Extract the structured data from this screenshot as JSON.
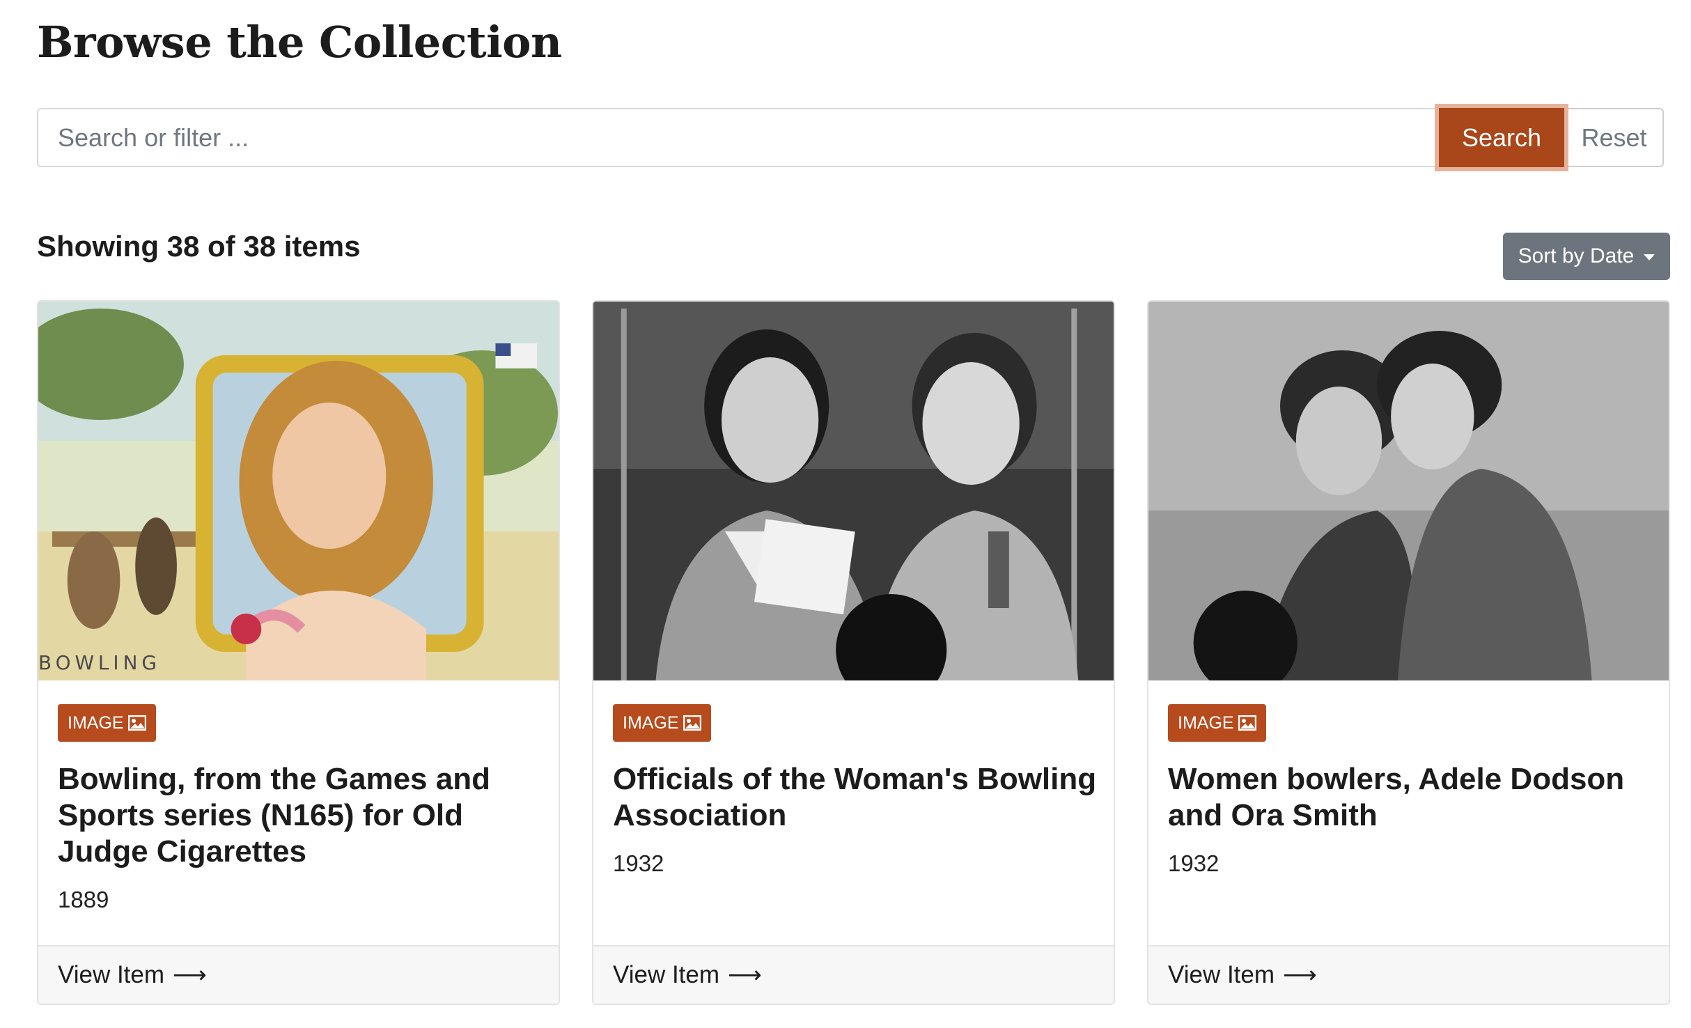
{
  "page": {
    "title": "Browse the Collection"
  },
  "search": {
    "placeholder": "Search or filter ...",
    "value": "",
    "search_label": "Search",
    "reset_label": "Reset"
  },
  "results": {
    "count_text": "Showing 38 of 38 items",
    "sort_label": "Sort by Date"
  },
  "colors": {
    "accent": "#b64c1e",
    "sort_button": "#6c757d"
  },
  "cards": [
    {
      "badge": "IMAGE",
      "badge_icon": "image-icon",
      "title": "Bowling, from the Games and Sports series (N165) for Old Judge Cigarettes",
      "date": "1889",
      "link": "View Item",
      "image_caption": "BOWLING"
    },
    {
      "badge": "IMAGE",
      "badge_icon": "image-icon",
      "title": "Officials of the Woman's Bowling Association",
      "date": "1932",
      "link": "View Item"
    },
    {
      "badge": "IMAGE",
      "badge_icon": "image-icon",
      "title": "Women bowlers, Adele Dodson and Ora Smith",
      "date": "1932",
      "link": "View Item"
    }
  ]
}
